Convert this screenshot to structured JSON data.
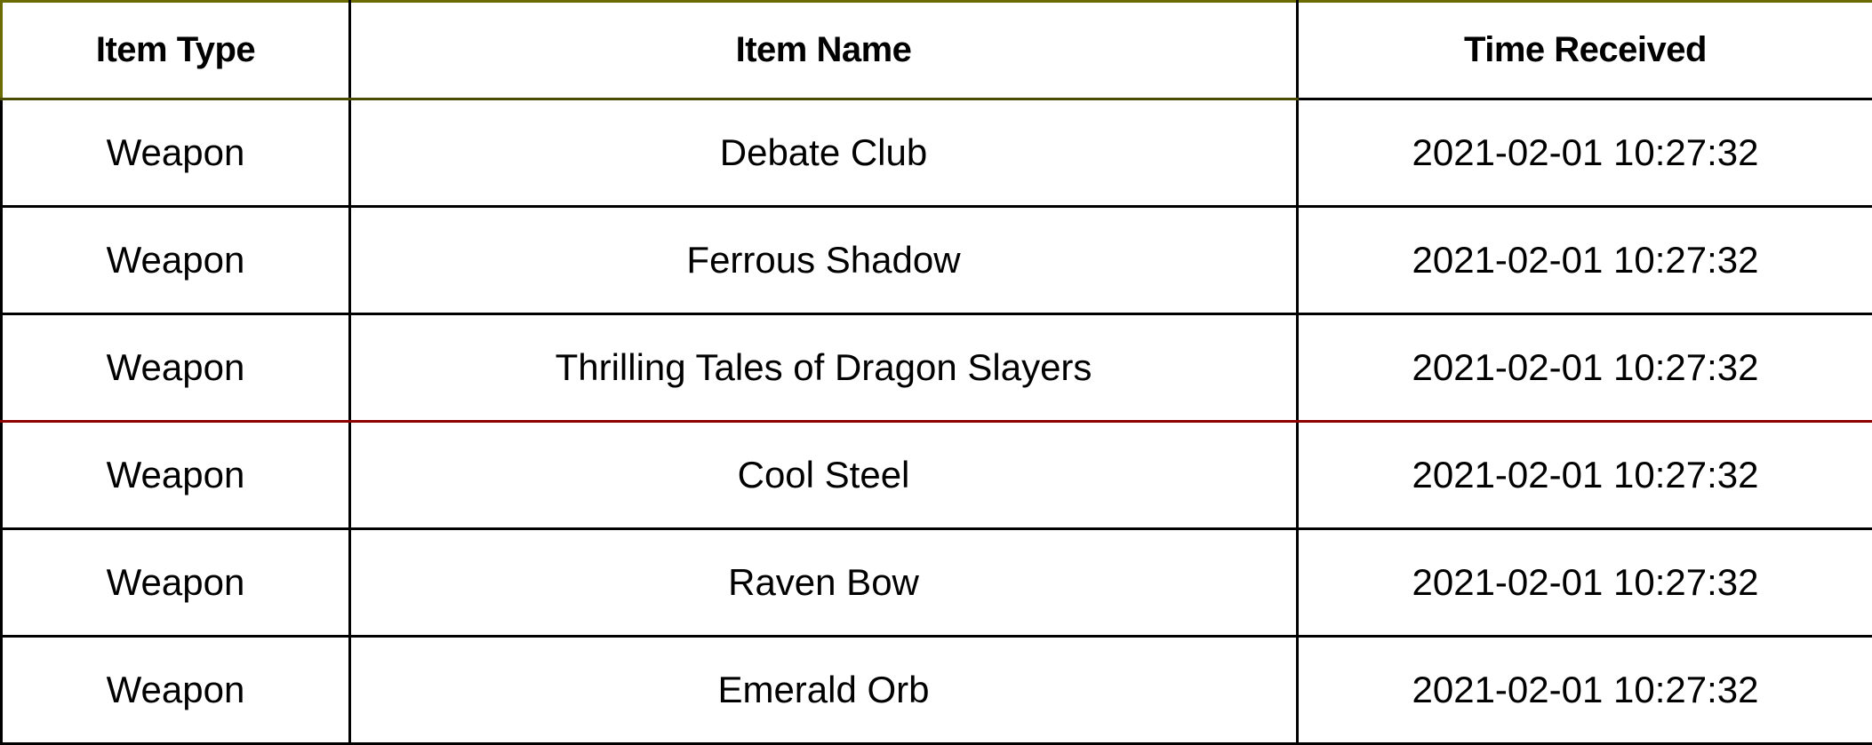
{
  "table": {
    "headers": {
      "type": "Item Type",
      "name": "Item Name",
      "time": "Time Received"
    },
    "rows": [
      {
        "type": "Weapon",
        "name": "Debate Club",
        "time": "2021-02-01 10:27:32"
      },
      {
        "type": "Weapon",
        "name": "Ferrous Shadow",
        "time": "2021-02-01 10:27:32"
      },
      {
        "type": "Weapon",
        "name": "Thrilling Tales of Dragon Slayers",
        "time": "2021-02-01 10:27:32"
      },
      {
        "type": "Weapon",
        "name": "Cool Steel",
        "time": "2021-02-01 10:27:32"
      },
      {
        "type": "Weapon",
        "name": "Raven Bow",
        "time": "2021-02-01 10:27:32"
      },
      {
        "type": "Weapon",
        "name": "Emerald Orb",
        "time": "2021-02-01 10:27:32"
      }
    ]
  },
  "colors": {
    "border": "#000000",
    "accent_line": "#8b0000",
    "text": "#000000",
    "background": "#ffffff"
  }
}
